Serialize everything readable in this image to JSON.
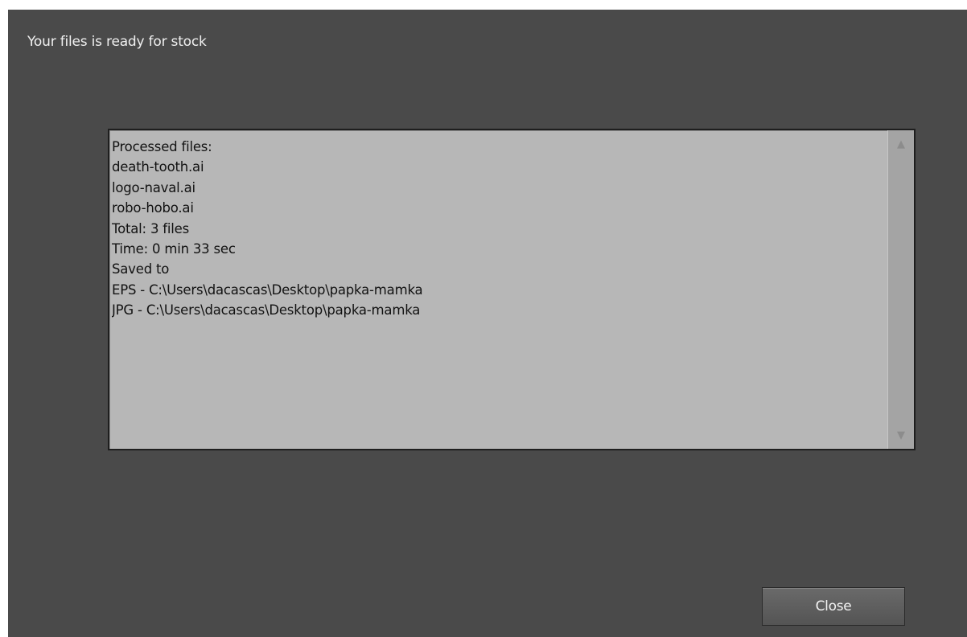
{
  "dialog": {
    "title": "Your files is ready for stock"
  },
  "log": {
    "lines": [
      "Processed files:",
      "death-tooth.ai",
      "logo-naval.ai",
      "robo-hobo.ai",
      "Total: 3 files",
      "Time: 0 min 33 sec",
      "Saved to",
      "EPS - C:\\Users\\dacascas\\Desktop\\papka-mamka",
      "JPG - C:\\Users\\dacascas\\Desktop\\papka-mamka"
    ]
  },
  "scrollbar": {
    "up_icon": "scroll-up-arrow-icon",
    "down_icon": "scroll-down-arrow-icon"
  },
  "buttons": {
    "close_label": "Close"
  }
}
